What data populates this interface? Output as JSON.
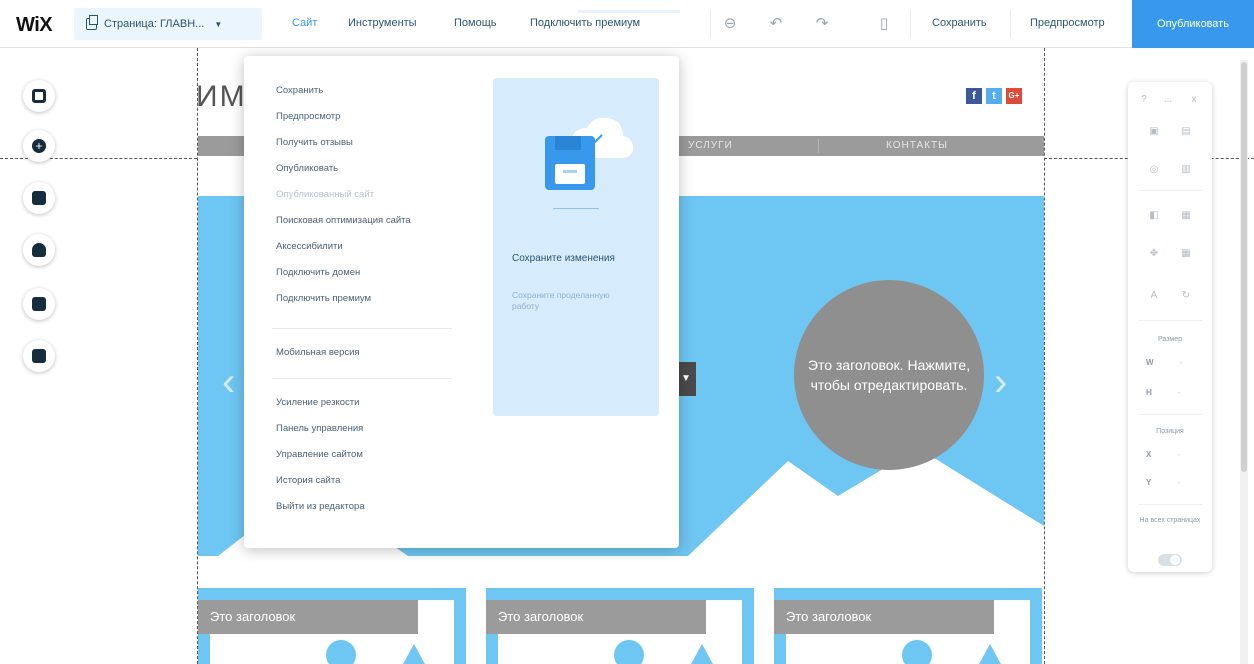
{
  "topbar": {
    "logo": "WiX",
    "pages_dropdown": "Страница: ГЛАВН...",
    "menu": [
      "Сайт",
      "Инструменты",
      "Помощь",
      "Подключить премиум"
    ],
    "save": "Сохранить",
    "preview": "Предпросмотр",
    "publish": "Опубликовать",
    "icons": [
      "zoom-out-icon",
      "undo-icon",
      "redo-icon",
      "mobile-view-icon"
    ]
  },
  "left_rail": [
    "add-icon",
    "plus-circle-icon",
    "background-icon",
    "upload-icon",
    "blog-icon",
    "app-market-icon"
  ],
  "site": {
    "title": "ИМ",
    "social": [
      {
        "label": "f",
        "color": "#3b5998"
      },
      {
        "label": "t",
        "color": "#55acee"
      },
      {
        "label": "G+",
        "color": "#dd4b39"
      }
    ],
    "nav": [
      "УСЛУГИ",
      "КОНТАКТЫ"
    ],
    "hero_heading": "Это заголовок. Нажмите, чтобы отредактировать.",
    "cards": [
      "Это заголовок",
      "Это заголовок",
      "Это заголовок"
    ]
  },
  "site_menu": {
    "group1": [
      {
        "label": "Сохранить",
        "disabled": false
      },
      {
        "label": "Предпросмотр",
        "disabled": false
      },
      {
        "label": "Получить отзывы",
        "disabled": false
      },
      {
        "label": "Опубликовать",
        "disabled": false
      },
      {
        "label": "Опубликованный сайт",
        "disabled": true
      },
      {
        "label": "Поисковая оптимизация сайта",
        "disabled": false
      },
      {
        "label": "Аксессибилити",
        "disabled": false
      },
      {
        "label": "Подключить домен",
        "disabled": false
      },
      {
        "label": "Подключить премиум",
        "disabled": false
      }
    ],
    "group2": [
      {
        "label": "Мобильная версия",
        "disabled": false
      }
    ],
    "group3": [
      {
        "label": "Усиление резкости",
        "disabled": false
      },
      {
        "label": "Панель управления",
        "disabled": false
      },
      {
        "label": "Управление сайтом",
        "disabled": false
      },
      {
        "label": "История сайта",
        "disabled": false
      },
      {
        "label": "Выйти из редактора",
        "disabled": false
      }
    ],
    "panel_title": "Сохраните изменения",
    "panel_subtitle": "Сохраните проделанную работу"
  },
  "props_panel": {
    "header": [
      "?",
      "...",
      "x"
    ],
    "size_label": "Размер",
    "w_label": "W",
    "h_label": "H",
    "position_label": "Позиция",
    "x_label": "X",
    "y_label": "Y",
    "all_pages_label": "На всех страницах",
    "placeholder": "-"
  }
}
